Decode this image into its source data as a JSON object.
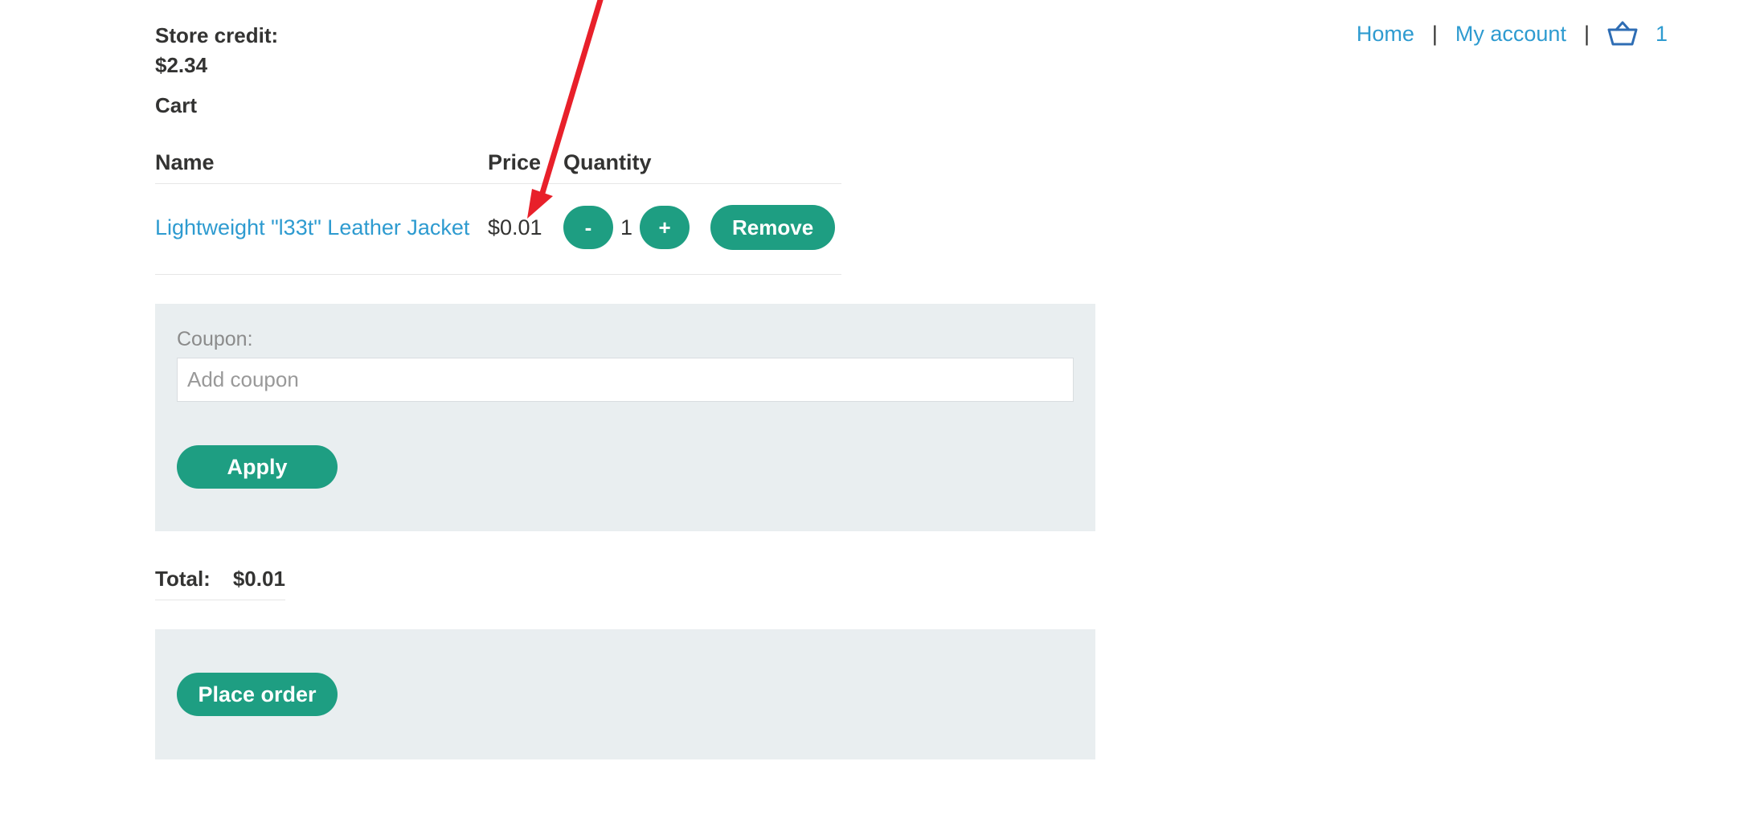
{
  "header": {
    "nav": {
      "home_label": "Home",
      "account_label": "My account",
      "separator": "|",
      "cart_count": "1",
      "cart_icon": "basket-icon"
    }
  },
  "store_credit": {
    "label": "Store credit:",
    "amount": "$2.34"
  },
  "cart": {
    "heading": "Cart",
    "columns": {
      "name": "Name",
      "price": "Price",
      "quantity": "Quantity"
    },
    "items": [
      {
        "name": "Lightweight \"l33t\" Leather Jacket",
        "price": "$0.01",
        "quantity": "1",
        "decrease_label": "-",
        "increase_label": "+",
        "remove_label": "Remove"
      }
    ]
  },
  "coupon": {
    "label": "Coupon:",
    "placeholder": "Add coupon",
    "value": "",
    "apply_label": "Apply"
  },
  "total": {
    "label": "Total:",
    "amount": "$0.01"
  },
  "order": {
    "place_order_label": "Place order"
  },
  "annotation": {
    "arrow_color": "#e8202a"
  },
  "colors": {
    "accent": "#1e9e82",
    "link": "#2e9bd0",
    "panel": "#e9eef0"
  }
}
